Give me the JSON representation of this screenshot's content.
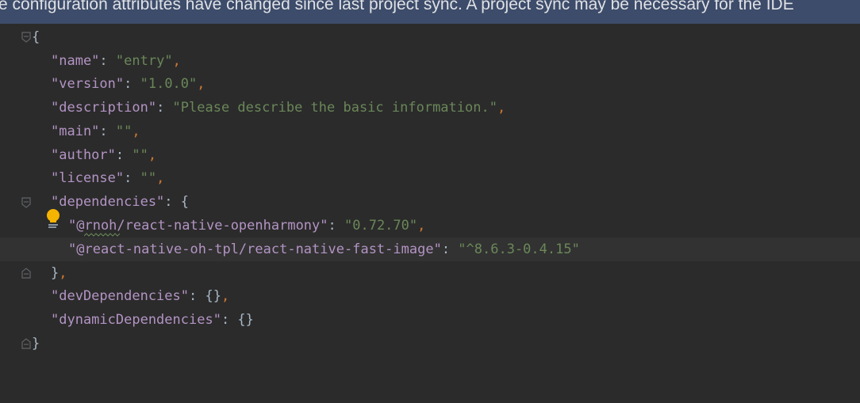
{
  "banner": {
    "text": "e configuration attributes have changed since last project sync. A project sync may be necessary for the IDE"
  },
  "colors": {
    "key": "#b394c4",
    "string": "#6a8759",
    "punct": "#cc7832",
    "brace": "#a9b7c6",
    "banner_bg": "#3d4c6a",
    "editor_bg": "#2b2b2b"
  },
  "editor": {
    "lines": [
      {
        "brace": "{"
      },
      {
        "key": "\"name\"",
        "colon": ": ",
        "value": "\"entry\"",
        "comma": ","
      },
      {
        "key": "\"version\"",
        "colon": ": ",
        "value": "\"1.0.0\"",
        "comma": ","
      },
      {
        "key": "\"description\"",
        "colon": ": ",
        "value": "\"Please describe the basic information.\"",
        "comma": ","
      },
      {
        "key": "\"main\"",
        "colon": ": ",
        "value": "\"\"",
        "comma": ","
      },
      {
        "key": "\"author\"",
        "colon": ": ",
        "value": "\"\"",
        "comma": ","
      },
      {
        "key": "\"license\"",
        "colon": ": ",
        "value": "\"\"",
        "comma": ","
      },
      {
        "key": "\"dependencies\"",
        "colon": ": ",
        "value": "{"
      },
      {
        "key": "\"@rnoh/react-native-openharmony\"",
        "colon": ": ",
        "value": "\"0.72.70\"",
        "comma": ","
      },
      {
        "key": "\"@react-native-oh-tpl/react-native-fast-image\"",
        "colon": ": ",
        "value": "\"^8.6.3-0.4.15\""
      },
      {
        "brace": "}",
        "comma": ","
      },
      {
        "key": "\"devDependencies\"",
        "colon": ": ",
        "value": "{}",
        "comma": ","
      },
      {
        "key": "\"dynamicDependencies\"",
        "colon": ": ",
        "value": "{}"
      },
      {
        "brace": "}"
      }
    ]
  },
  "icons": {
    "fold": "fold-marker-icon",
    "bulb": "lightbulb-icon"
  }
}
